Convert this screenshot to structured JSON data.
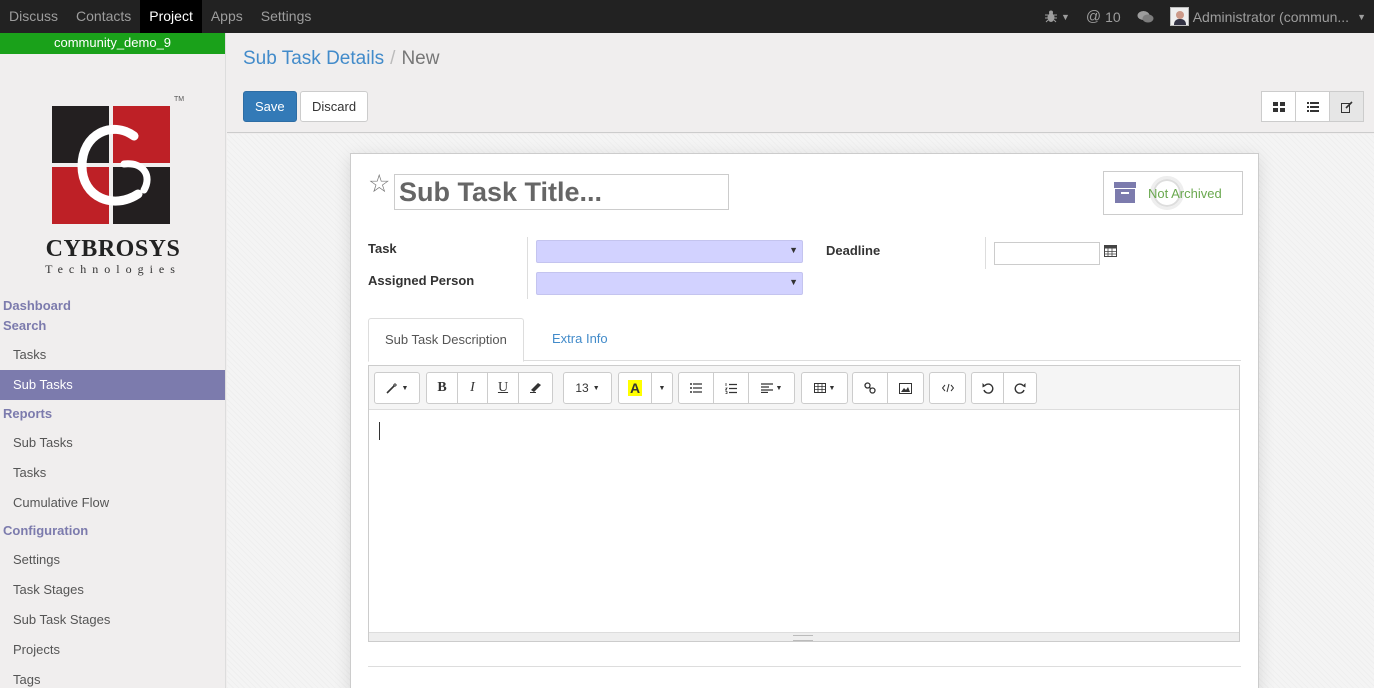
{
  "topbar": {
    "menu": [
      "Discuss",
      "Contacts",
      "Project",
      "Apps",
      "Settings"
    ],
    "active_menu": "Project",
    "messages_count": "10",
    "user": "Administrator (commun..."
  },
  "sidebar": {
    "db_name": "community_demo_9",
    "logo": {
      "name": "CYBROSYS",
      "sub": "Technologies",
      "tm": "TM"
    },
    "sections": [
      {
        "header": "Dashboard",
        "items": []
      },
      {
        "header": "Search",
        "items": [
          "Tasks",
          "Sub Tasks"
        ]
      },
      {
        "header": "Reports",
        "items": [
          "Sub Tasks",
          "Tasks",
          "Cumulative Flow"
        ]
      },
      {
        "header": "Configuration",
        "items": [
          "Settings",
          "Task Stages",
          "Sub Task Stages",
          "Projects",
          "Tags"
        ]
      }
    ],
    "active_item": "Sub Tasks"
  },
  "control_panel": {
    "breadcrumb_parent": "Sub Task Details",
    "breadcrumb_sep": "/",
    "breadcrumb_current": "New",
    "save_label": "Save",
    "discard_label": "Discard",
    "views": [
      "kanban",
      "list",
      "form"
    ],
    "active_view": "form"
  },
  "form": {
    "title_placeholder": "Sub Task Title...",
    "archive_label": "Not Archived",
    "task_label": "Task",
    "assigned_label": "Assigned Person",
    "deadline_label": "Deadline",
    "task_value": "",
    "assigned_value": "",
    "deadline_value": "",
    "tabs": [
      "Sub Task Description",
      "Extra Info"
    ],
    "active_tab": "Sub Task Description"
  },
  "editor_toolbar": {
    "font_size": "13",
    "bold": "B",
    "italic": "I",
    "underline": "U",
    "highlight": "A"
  },
  "colors": {
    "topbar_bg": "#222222",
    "db_badge": "#1aa11a",
    "accent": "#7c7bad",
    "link": "#428bca",
    "primary_button": "#337ab7",
    "select_bg": "#d2d2ff"
  }
}
